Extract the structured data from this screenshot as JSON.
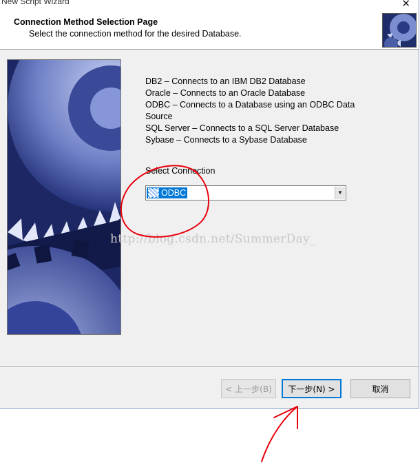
{
  "window": {
    "title": "New Script Wizard",
    "close_glyph": "✕"
  },
  "header": {
    "title": "Connection Method Selection Page",
    "subtitle": "Select the connection method for the desired Database.",
    "icon": "gears-icon"
  },
  "descriptions": [
    "DB2 – Connects to an IBM DB2 Database",
    "Oracle – Connects to an Oracle Database",
    "ODBC – Connects to a Database using an ODBC Data",
    "Source",
    "SQL Server – Connects to a SQL Server Database",
    "Sybase – Connects to a Sybase Database"
  ],
  "connection": {
    "label": "Select Connection",
    "selected": "ODBC",
    "arrow": "▼"
  },
  "watermark": "http://blog.csdn.net/SummerDay_",
  "buttons": {
    "back": "< 上一步(B)",
    "next": "下一步(N) >",
    "cancel": "取消"
  },
  "colors": {
    "selection": "#0078d7",
    "annotation": "#e8000b",
    "gear": "#5a6fb0"
  }
}
